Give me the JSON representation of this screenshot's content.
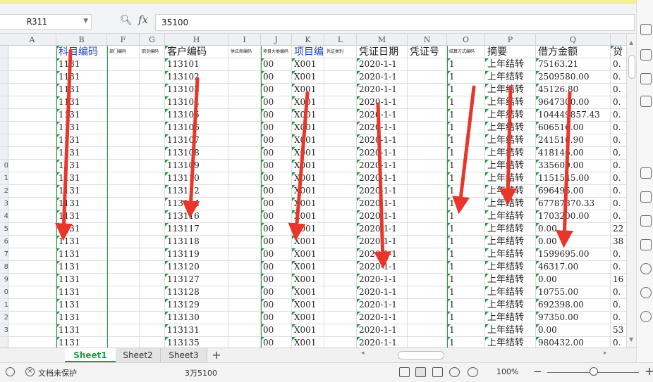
{
  "formula_bar": {
    "name_box": "R311",
    "formula": "35100"
  },
  "columns": [
    "A",
    "B",
    "F",
    "G",
    "H",
    "I",
    "J",
    "K",
    "L",
    "M",
    "N",
    "O",
    "P",
    "Q"
  ],
  "row_numbers": [
    "",
    "",
    "",
    "",
    "",
    "",
    "",
    "",
    "",
    "0",
    "1",
    "2",
    "3",
    "4",
    "5",
    "6",
    "7",
    "8",
    "9",
    "0",
    "1",
    "2",
    "3",
    ""
  ],
  "header_row": {
    "B": "科目编码",
    "F": "部门编码",
    "G": "职员编码",
    "H": "客户编码",
    "I": "供应商编码",
    "J": "项目大类编码",
    "K": "项目编码",
    "L": "凭证类别",
    "M": "凭证日期",
    "N": "凭证号",
    "O": "结算方式编码",
    "P": "摘要",
    "Q": "借方金额",
    "R": "贷"
  },
  "rows": [
    {
      "B": "1131",
      "H": "113101",
      "J": "00",
      "K": "X001",
      "M": "2020-1-1",
      "O": "1",
      "P": "上年结转",
      "Q": "75163.21",
      "R": "0."
    },
    {
      "B": "1131",
      "H": "113102",
      "J": "00",
      "K": "X001",
      "M": "2020-1-1",
      "O": "1",
      "P": "上年结转",
      "Q": "2509580.00",
      "R": "0."
    },
    {
      "B": "1131",
      "H": "113103",
      "J": "00",
      "K": "X001",
      "M": "2020-1-1",
      "O": "1",
      "P": "上年结转",
      "Q": "45126.80",
      "R": "0."
    },
    {
      "B": "1131",
      "H": "113104",
      "J": "00",
      "K": "X001",
      "M": "2020-1-1",
      "O": "1",
      "P": "上年结转",
      "Q": "9647300.00",
      "R": "0."
    },
    {
      "B": "1131",
      "H": "113105",
      "J": "00",
      "K": "X001",
      "M": "2020-1-1",
      "O": "1",
      "P": "上年结转",
      "Q": "104449857.43",
      "R": "0."
    },
    {
      "B": "1131",
      "H": "113106",
      "J": "00",
      "K": "X001",
      "M": "2020-1-1",
      "O": "1",
      "P": "上年结转",
      "Q": "606516.00",
      "R": "0."
    },
    {
      "B": "1131",
      "H": "113107",
      "J": "00",
      "K": "X001",
      "M": "2020-1-1",
      "O": "1",
      "P": "上年结转",
      "Q": "241510.90",
      "R": "0."
    },
    {
      "B": "1131",
      "H": "113108",
      "J": "00",
      "K": "X001",
      "M": "2020-1-1",
      "O": "1",
      "P": "上年结转",
      "Q": "418146.00",
      "R": "0."
    },
    {
      "B": "1131",
      "H": "113109",
      "J": "00",
      "K": "X001",
      "M": "2020-1-1",
      "O": "1",
      "P": "上年结转",
      "Q": "335609.00",
      "R": "0."
    },
    {
      "B": "1131",
      "H": "113110",
      "J": "00",
      "K": "X001",
      "M": "2020-1-1",
      "O": "1",
      "P": "上年结转",
      "Q": "1151545.00",
      "R": "0."
    },
    {
      "B": "1131",
      "H": "113112",
      "J": "00",
      "K": "X001",
      "M": "2020-1-1",
      "O": "1",
      "P": "上年结转",
      "Q": "696495.00",
      "R": "0."
    },
    {
      "B": "1131",
      "H": "113114",
      "J": "00",
      "K": "X001",
      "M": "2020-1-1",
      "O": "1",
      "P": "上年结转",
      "Q": "67787870.33",
      "R": "0."
    },
    {
      "B": "1131",
      "H": "113116",
      "J": "00",
      "K": "X001",
      "M": "2020-1-1",
      "O": "1",
      "P": "上年结转",
      "Q": "1703200.00",
      "R": "0."
    },
    {
      "B": "1131",
      "H": "113117",
      "J": "00",
      "K": "X001",
      "M": "2020-1-1",
      "O": "1",
      "P": "上年结转",
      "Q": "0.00",
      "R": "22"
    },
    {
      "B": "1131",
      "H": "113118",
      "J": "00",
      "K": "X001",
      "M": "2020-1-1",
      "O": "1",
      "P": "上年结转",
      "Q": "0.00",
      "R": "38"
    },
    {
      "B": "1131",
      "H": "113119",
      "J": "00",
      "K": "X001",
      "M": "2020-1-1",
      "O": "1",
      "P": "上年结转",
      "Q": "1599695.00",
      "R": "0."
    },
    {
      "B": "1131",
      "H": "113120",
      "J": "00",
      "K": "X001",
      "M": "2020-1-1",
      "O": "1",
      "P": "上年结转",
      "Q": "46317.00",
      "R": "0."
    },
    {
      "B": "1131",
      "H": "113127",
      "J": "00",
      "K": "X001",
      "M": "2020-1-1",
      "O": "1",
      "P": "上年结转",
      "Q": "0.00",
      "R": "16"
    },
    {
      "B": "1131",
      "H": "113128",
      "J": "00",
      "K": "X001",
      "M": "2020-1-1",
      "O": "1",
      "P": "上年结转",
      "Q": "10755.00",
      "R": "0."
    },
    {
      "B": "1131",
      "H": "113129",
      "J": "00",
      "K": "X001",
      "M": "2020-1-1",
      "O": "1",
      "P": "上年结转",
      "Q": "692398.00",
      "R": "0."
    },
    {
      "B": "1131",
      "H": "113130",
      "J": "00",
      "K": "X001",
      "M": "2020-1-1",
      "O": "1",
      "P": "上年结转",
      "Q": "97350.00",
      "R": "0."
    },
    {
      "B": "1131",
      "H": "113131",
      "J": "00",
      "K": "X001",
      "M": "2020-1-1",
      "O": "1",
      "P": "上年结转",
      "Q": "0.00",
      "R": "53"
    },
    {
      "B": "1131",
      "H": "113135",
      "J": "00",
      "K": "X001",
      "M": "2020-1-1",
      "O": "1",
      "P": "上年结转",
      "Q": "980432.00",
      "R": "0."
    }
  ],
  "sheet_tabs": [
    "Sheet1",
    "Sheet2",
    "Sheet3"
  ],
  "active_tab": "Sheet1",
  "status_bar": {
    "protection": "文档未保护",
    "sum": "3万5100",
    "zoom": "100%"
  },
  "icons": [
    "zoom-formula-icon",
    "fx-icon",
    "add-sheet-icon",
    "view-normal-icon",
    "view-page-icon",
    "zoom-slider-icon",
    "eye-icon"
  ],
  "colors": {
    "tab_active": "#1aa046",
    "header_blue": "#1d3fbf",
    "arrow_red": "#e8362b",
    "cell_marker": "#1f9d3a"
  }
}
